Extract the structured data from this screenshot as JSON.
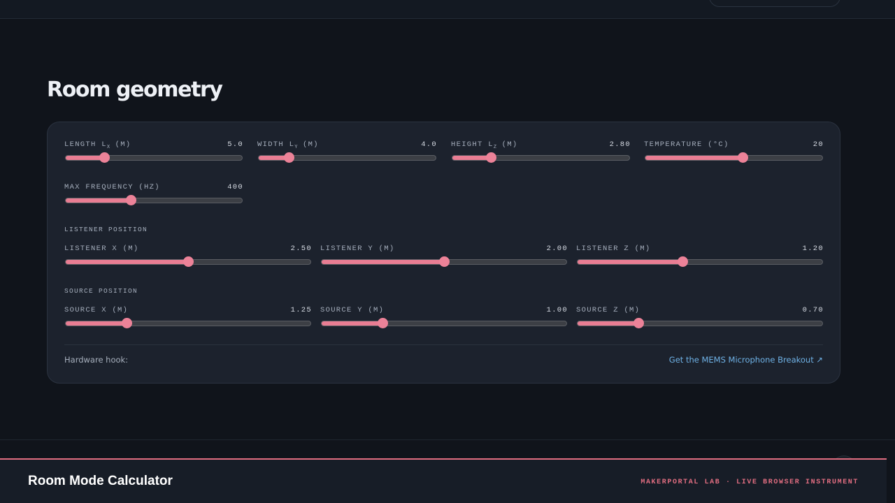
{
  "section": {
    "title": "Room geometry"
  },
  "room": {
    "length": {
      "label": "Length L",
      "sub": "x",
      "unit": "(m)",
      "value": "5.0",
      "fraction": 0.22
    },
    "width": {
      "label": "Width L",
      "sub": "y",
      "unit": "(m)",
      "value": "4.0",
      "fraction": 0.17
    },
    "height": {
      "label": "Height L",
      "sub": "z",
      "unit": "(m)",
      "value": "2.80",
      "fraction": 0.22
    },
    "temperature": {
      "label": "Temperature (°C)",
      "value": "20",
      "fraction": 0.55
    },
    "max_frequency": {
      "label": "Max frequency (Hz)",
      "value": "400",
      "fraction": 0.37
    }
  },
  "listener": {
    "group_label": "Listener position",
    "x": {
      "label": "Listener X (m)",
      "value": "2.50",
      "fraction": 0.5
    },
    "y": {
      "label": "Listener Y (m)",
      "value": "2.00",
      "fraction": 0.5
    },
    "z": {
      "label": "Listener Z (m)",
      "value": "1.20",
      "fraction": 0.43
    }
  },
  "source": {
    "group_label": "Source position",
    "x": {
      "label": "Source X (m)",
      "value": "1.25",
      "fraction": 0.25
    },
    "y": {
      "label": "Source Y (m)",
      "value": "1.00",
      "fraction": 0.25
    },
    "z": {
      "label": "Source Z (m)",
      "value": "0.70",
      "fraction": 0.25
    }
  },
  "hardware": {
    "label": "Hardware hook:",
    "link_text": "Get the MEMS Microphone Breakout ↗"
  },
  "footer": {
    "title": "Room Mode Calculator",
    "tagline": "Makerportal Lab · Live Browser Instrument"
  },
  "scroll_top": {
    "icon": "arrow-up-icon",
    "glyph": "↑"
  },
  "colors": {
    "accent": "#e97d93",
    "link": "#6fb2e6",
    "background": "#10141b",
    "card": "#1c222d"
  }
}
